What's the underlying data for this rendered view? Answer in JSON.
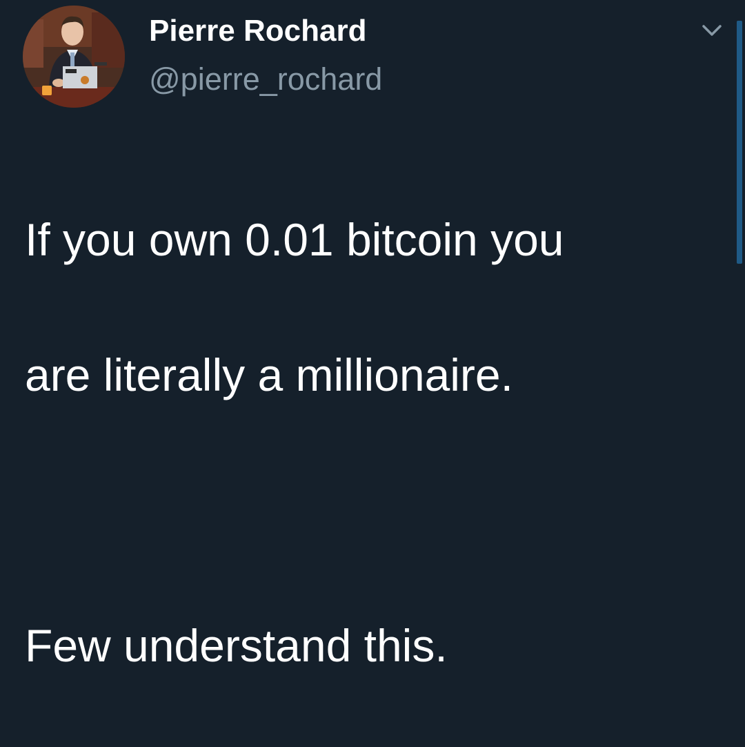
{
  "author": {
    "display_name": "Pierre Rochard",
    "handle": "@pierre_rochard",
    "avatar_icon": "profile-photo"
  },
  "menu": {
    "icon": "chevron-down-icon"
  },
  "tweet": {
    "lines": [
      "If you own 0.01 bitcoin you",
      "are literally a millionaire.",
      "Few understand this."
    ]
  },
  "theme": {
    "background": "#15202b",
    "text": "#ffffff",
    "secondary_text": "#8899a6",
    "accent": "#1f5a86"
  }
}
